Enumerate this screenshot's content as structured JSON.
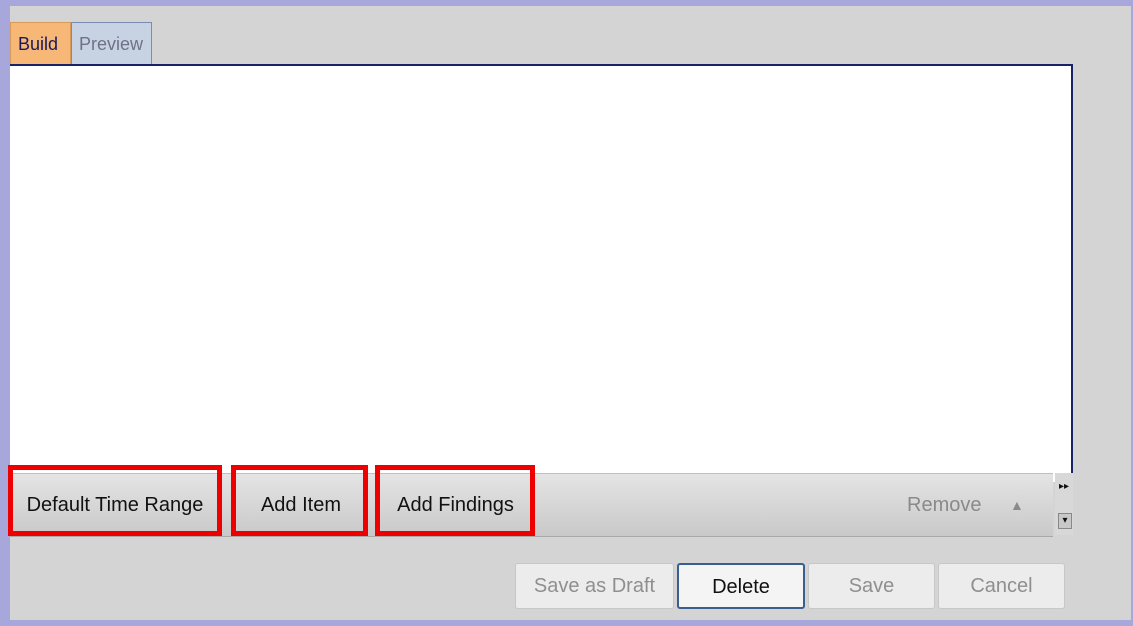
{
  "tabs": {
    "build": "Build",
    "preview": "Preview"
  },
  "action_bar": {
    "default_time_range": "Default Time Range",
    "add_item": "Add Item",
    "add_findings": "Add Findings",
    "remove": "Remove",
    "remove_arrow": "▲"
  },
  "scroll": {
    "top_glyph": "▸▸",
    "bottom_glyph": "▾"
  },
  "dialog_buttons": {
    "save_as_draft": {
      "label": "Save as Draft",
      "enabled": false
    },
    "delete": {
      "label": "Delete",
      "enabled": true
    },
    "save": {
      "label": "Save",
      "enabled": false
    },
    "cancel": {
      "label": "Cancel",
      "enabled": false
    }
  },
  "colors": {
    "highlight": "#ee0000",
    "active_tab": "#f7b877",
    "inactive_tab": "#c7d2e3",
    "background": "#a7a7dc"
  }
}
